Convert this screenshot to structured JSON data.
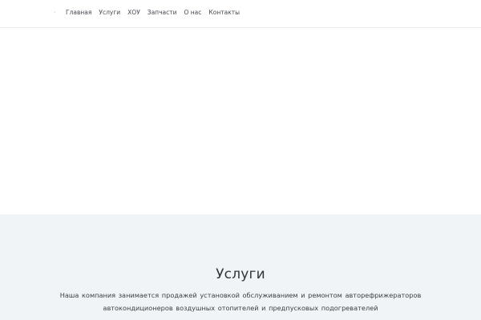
{
  "header": {
    "logo_text": "·",
    "nav": [
      {
        "label": "Главная"
      },
      {
        "label": "Услуги"
      },
      {
        "label": "ХОУ"
      },
      {
        "label": "Запчасти"
      },
      {
        "label": "О нас"
      },
      {
        "label": "Контакты"
      }
    ]
  },
  "services": {
    "title": "Услуги",
    "text": "Наша компания занимается продажей  установкой  обслуживанием и ремонтом авторефрижераторов автокондиционеров  воздушных отопителей и предпусковых подогревателей"
  },
  "colors": {
    "page_background": "#ffffff",
    "services_background": "#f1f4f7",
    "text_primary": "#30353a",
    "nav_text": "#444a50"
  }
}
